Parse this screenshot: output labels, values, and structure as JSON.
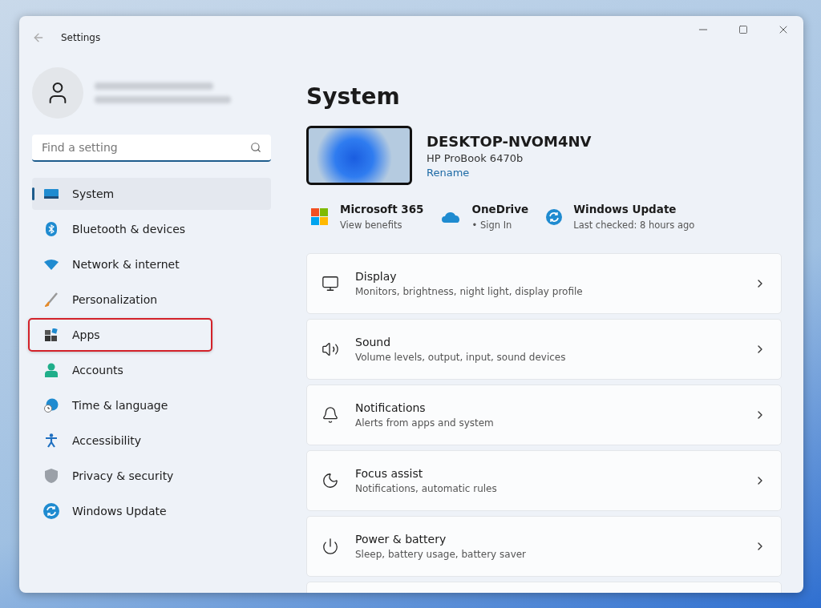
{
  "window": {
    "title": "Settings"
  },
  "search": {
    "placeholder": "Find a setting"
  },
  "sidebar": {
    "items": [
      {
        "label": "System",
        "selected": true,
        "highlighted": false
      },
      {
        "label": "Bluetooth & devices",
        "selected": false,
        "highlighted": false
      },
      {
        "label": "Network & internet",
        "selected": false,
        "highlighted": false
      },
      {
        "label": "Personalization",
        "selected": false,
        "highlighted": false
      },
      {
        "label": "Apps",
        "selected": false,
        "highlighted": true
      },
      {
        "label": "Accounts",
        "selected": false,
        "highlighted": false
      },
      {
        "label": "Time & language",
        "selected": false,
        "highlighted": false
      },
      {
        "label": "Accessibility",
        "selected": false,
        "highlighted": false
      },
      {
        "label": "Privacy & security",
        "selected": false,
        "highlighted": false
      },
      {
        "label": "Windows Update",
        "selected": false,
        "highlighted": false
      }
    ]
  },
  "page": {
    "title": "System"
  },
  "device": {
    "name": "DESKTOP-NVOM4NV",
    "model": "HP ProBook 6470b",
    "rename": "Rename"
  },
  "quick_links": [
    {
      "title": "Microsoft 365",
      "subtitle": "View benefits"
    },
    {
      "title": "OneDrive",
      "subtitle": "• Sign In"
    },
    {
      "title": "Windows Update",
      "subtitle": "Last checked: 8 hours ago"
    }
  ],
  "settings": [
    {
      "title": "Display",
      "subtitle": "Monitors, brightness, night light, display profile"
    },
    {
      "title": "Sound",
      "subtitle": "Volume levels, output, input, sound devices"
    },
    {
      "title": "Notifications",
      "subtitle": "Alerts from apps and system"
    },
    {
      "title": "Focus assist",
      "subtitle": "Notifications, automatic rules"
    },
    {
      "title": "Power & battery",
      "subtitle": "Sleep, battery usage, battery saver"
    }
  ]
}
